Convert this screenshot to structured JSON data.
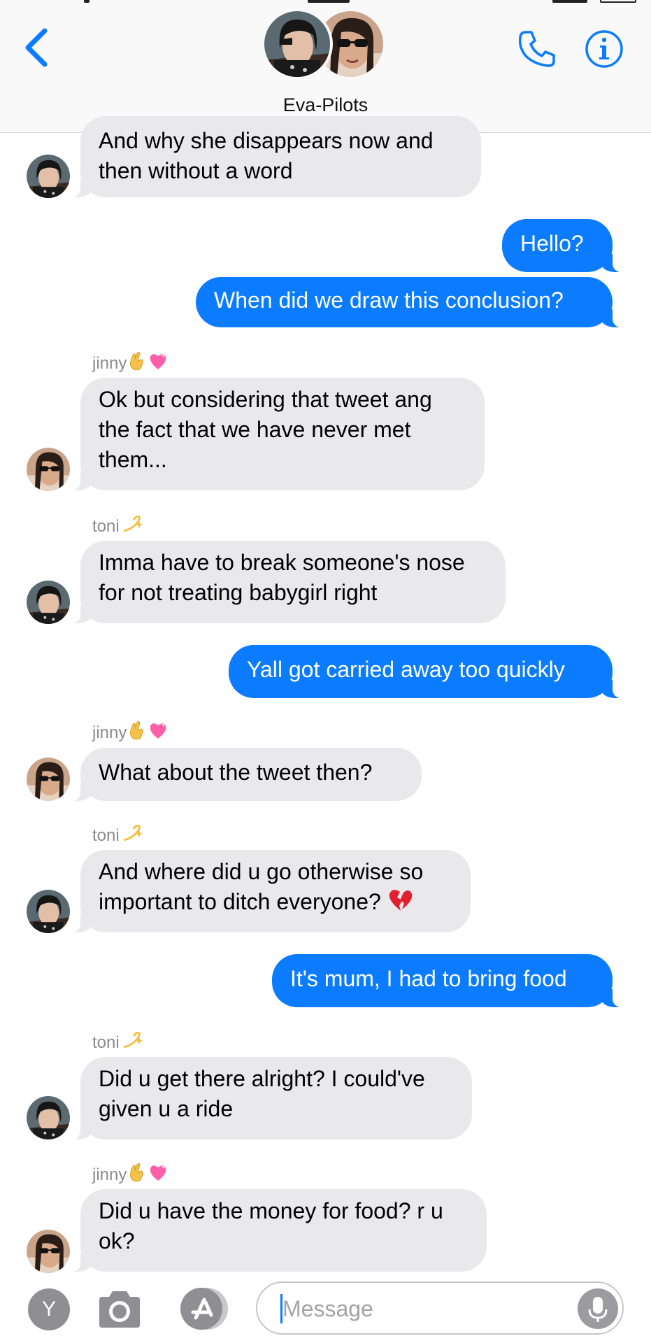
{
  "header": {
    "title": "Eva-Pilots",
    "accent_color": "#0b7cff",
    "icons": [
      "chevron-left-icon",
      "phone-icon",
      "info-icon"
    ]
  },
  "senders": {
    "jinny": "jinny",
    "toni": "toni"
  },
  "messages": [
    {
      "from": "toni",
      "text": "And why she disappears now and\nthen without a word"
    },
    {
      "from": "me",
      "text": "Hello?"
    },
    {
      "from": "me",
      "text": "When did we draw this conclusion?"
    },
    {
      "from": "jinny",
      "text": "Ok but considering that tweet ang\nthe fact that we have never met\nthem..."
    },
    {
      "from": "toni",
      "text": "Imma have to break someone's nose\nfor not treating babygirl right"
    },
    {
      "from": "me",
      "text": "Yall got carried away too quickly"
    },
    {
      "from": "jinny",
      "text": "What about the tweet then?"
    },
    {
      "from": "toni",
      "text": "And where did u go otherwise so\nimportant to ditch everyone?",
      "emoji": "broken-heart-icon"
    },
    {
      "from": "me",
      "text": "It's mum, I had to bring food"
    },
    {
      "from": "toni",
      "text": "Did u get there alright? I could've\ngiven u a ride"
    },
    {
      "from": "jinny",
      "text": "Did u have the money for food? r u\nok?"
    }
  ],
  "composer": {
    "placeholder": "Message",
    "apps": [
      {
        "icon": "y-app-icon",
        "label": "Y"
      },
      {
        "icon": "camera-icon"
      },
      {
        "icon": "app-store-icon"
      }
    ]
  },
  "colors": {
    "incoming_bubble": "#e9e9eb",
    "outgoing_bubble": "#0b7cff"
  }
}
